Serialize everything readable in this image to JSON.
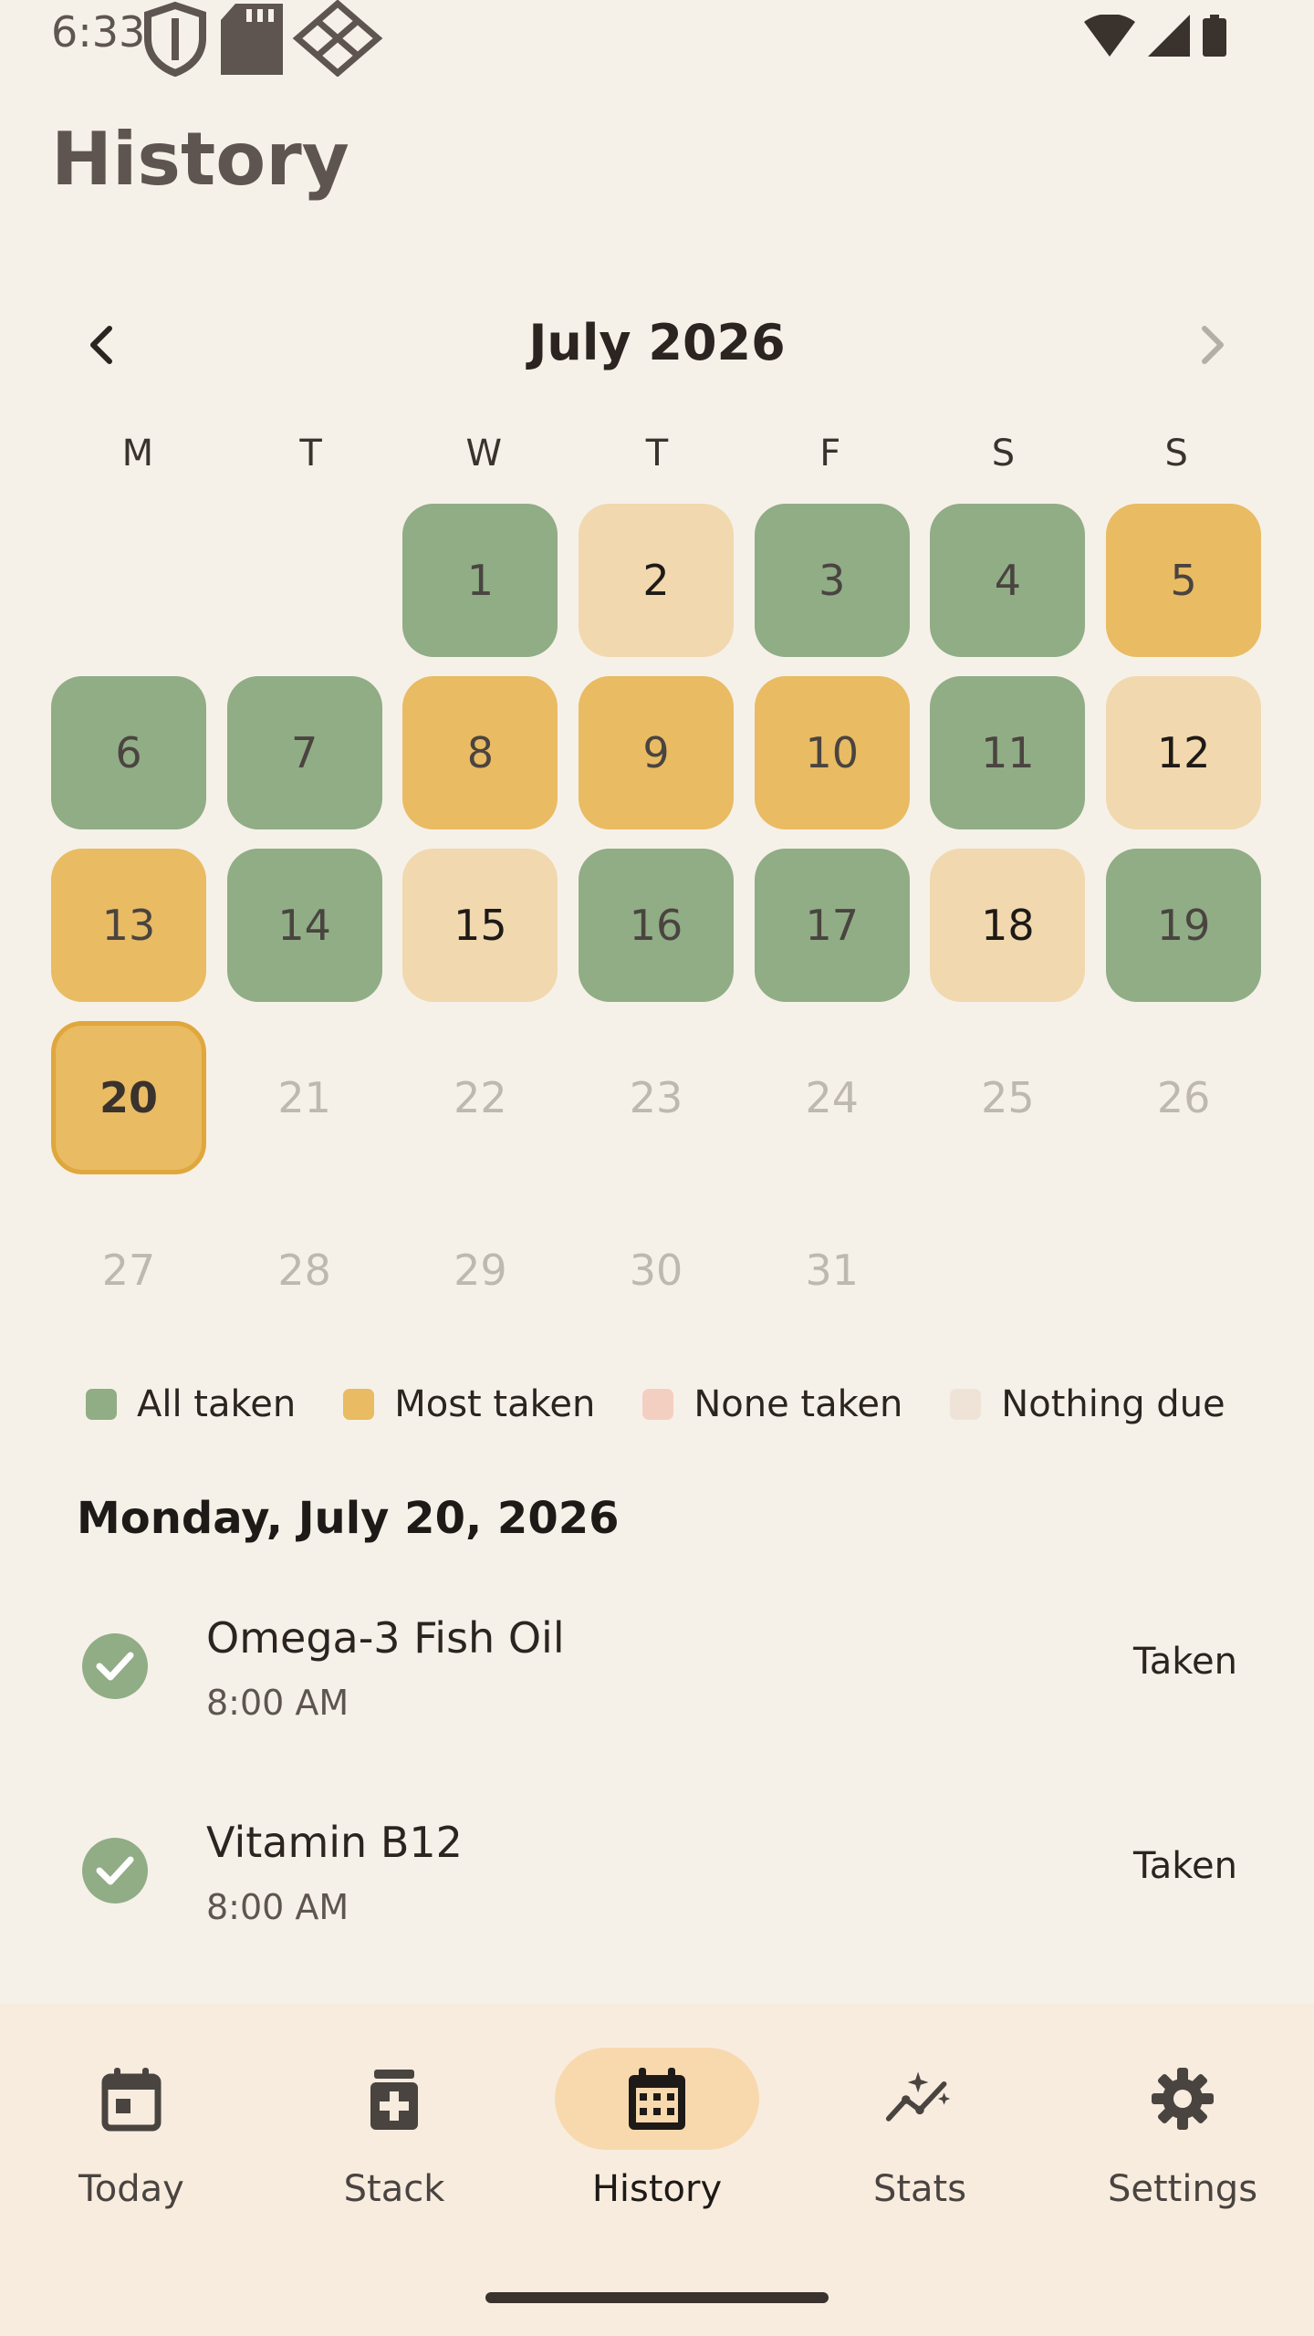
{
  "status_bar": {
    "time": "6:33"
  },
  "page": {
    "title": "History"
  },
  "calendar": {
    "month_label": "July 2026",
    "weekdays": [
      "M",
      "T",
      "W",
      "T",
      "F",
      "S",
      "S"
    ],
    "days": [
      {
        "label": "",
        "status": "empty"
      },
      {
        "label": "",
        "status": "empty"
      },
      {
        "label": "1",
        "status": "all"
      },
      {
        "label": "2",
        "status": "partial"
      },
      {
        "label": "3",
        "status": "all"
      },
      {
        "label": "4",
        "status": "all"
      },
      {
        "label": "5",
        "status": "most"
      },
      {
        "label": "6",
        "status": "all"
      },
      {
        "label": "7",
        "status": "all"
      },
      {
        "label": "8",
        "status": "most"
      },
      {
        "label": "9",
        "status": "most"
      },
      {
        "label": "10",
        "status": "most"
      },
      {
        "label": "11",
        "status": "all"
      },
      {
        "label": "12",
        "status": "partial"
      },
      {
        "label": "13",
        "status": "most"
      },
      {
        "label": "14",
        "status": "all"
      },
      {
        "label": "15",
        "status": "partial"
      },
      {
        "label": "16",
        "status": "all"
      },
      {
        "label": "17",
        "status": "all"
      },
      {
        "label": "18",
        "status": "partial"
      },
      {
        "label": "19",
        "status": "all"
      },
      {
        "label": "20",
        "status": "most selected"
      },
      {
        "label": "21",
        "status": "future"
      },
      {
        "label": "22",
        "status": "future"
      },
      {
        "label": "23",
        "status": "future"
      },
      {
        "label": "24",
        "status": "future"
      },
      {
        "label": "25",
        "status": "future"
      },
      {
        "label": "26",
        "status": "future"
      },
      {
        "label": "27",
        "status": "future"
      },
      {
        "label": "28",
        "status": "future"
      },
      {
        "label": "29",
        "status": "future"
      },
      {
        "label": "30",
        "status": "future"
      },
      {
        "label": "31",
        "status": "future"
      }
    ]
  },
  "legend": [
    {
      "label": "All taken",
      "color": "#90AD86"
    },
    {
      "label": "Most taken",
      "color": "#E9BB63"
    },
    {
      "label": "None taken",
      "color": "#F3CFC2"
    },
    {
      "label": "Nothing due",
      "color": "#EFE3D7"
    }
  ],
  "selected_date": {
    "heading": "Monday, July 20, 2026"
  },
  "doses": [
    {
      "name": "Omega-3 Fish Oil",
      "time": "8:00 AM",
      "status": "Taken"
    },
    {
      "name": "Vitamin B12",
      "time": "8:00 AM",
      "status": "Taken"
    }
  ],
  "bottom_nav": [
    {
      "label": "Today",
      "icon": "calendar-today-icon",
      "active": false
    },
    {
      "label": "Stack",
      "icon": "medicine-bottle-icon",
      "active": false
    },
    {
      "label": "History",
      "icon": "calendar-month-icon",
      "active": true
    },
    {
      "label": "Stats",
      "icon": "trending-sparkle-icon",
      "active": false
    },
    {
      "label": "Settings",
      "icon": "gear-icon",
      "active": false
    }
  ],
  "colors": {
    "background": "#F6F1E8",
    "all_taken": "#90AD86",
    "most_taken": "#E9BB63",
    "partial": "#F1D8AE",
    "nav_background": "#F8ECDF",
    "nav_active_pill": "#F8D9AE"
  }
}
